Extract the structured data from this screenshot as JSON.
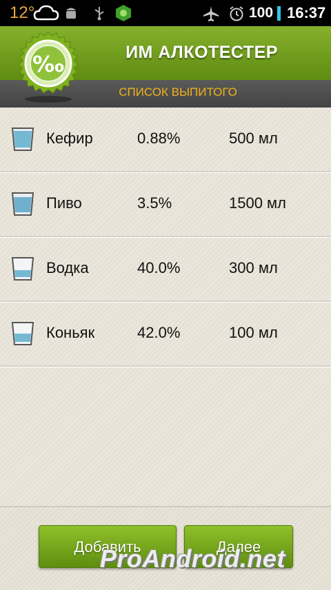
{
  "status_bar": {
    "temperature": "12°",
    "icons": [
      "cloud-icon",
      "android-debug-icon",
      "usb-icon",
      "security-shield-icon",
      "airplane-mode-icon",
      "alarm-icon"
    ],
    "battery": "100",
    "time": "16:37"
  },
  "header": {
    "title": "ИМ АЛКОТЕСТЕР",
    "subtitle": "СПИСОК ВЫПИТОГО",
    "logo_icon": "percent-mille-badge-icon",
    "logo_symbol": "‰"
  },
  "drinks": [
    {
      "name": "Кефир",
      "percent": "0.88%",
      "volume": "500 мл",
      "icon": "glass-icon"
    },
    {
      "name": "Пиво",
      "percent": "3.5%",
      "volume": "1500 мл",
      "icon": "glass-icon"
    },
    {
      "name": "Водка",
      "percent": "40.0%",
      "volume": "300 мл",
      "icon": "glass-icon"
    },
    {
      "name": "Коньяк",
      "percent": "42.0%",
      "volume": "100 мл",
      "icon": "glass-icon"
    }
  ],
  "buttons": {
    "add": "Добавить",
    "next": "Далее"
  },
  "watermark": "ProAndroid.net",
  "colors": {
    "header_green": "#6f9e1d",
    "subheader_gray": "#4e4e4e",
    "subtitle_orange": "#f2b21b",
    "button_green": "#78a91d",
    "glass_water": "#6fb6d2"
  }
}
